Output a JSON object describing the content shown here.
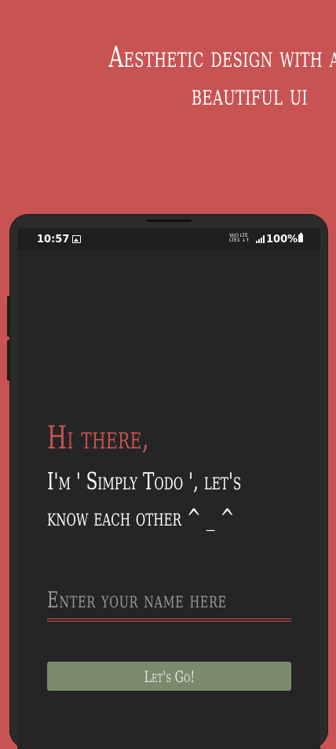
{
  "promo": {
    "headline_line1": "Aesthetic design with a",
    "headline_line2": "beautiful ui"
  },
  "status_bar": {
    "time": "10:57",
    "gallery_icon": "gallery-icon",
    "network_line1": "Vo)) LTE",
    "network_line2": "LTE1 ↓↑",
    "battery_percent": "100%",
    "battery_icon": "battery-icon",
    "signal_icon": "signal-icon"
  },
  "onboarding": {
    "greeting": "Hi there,",
    "intro_line1": "I'm ' Simply Todo ', let's",
    "intro_line2": "know each other ^ _ ^",
    "name_placeholder": "Enter your name here",
    "name_value": "",
    "go_button_label": "Let's Go!"
  },
  "colors": {
    "background": "#c85353",
    "accent": "#c85353",
    "screen": "#252525",
    "button": "#7a8a6c"
  }
}
